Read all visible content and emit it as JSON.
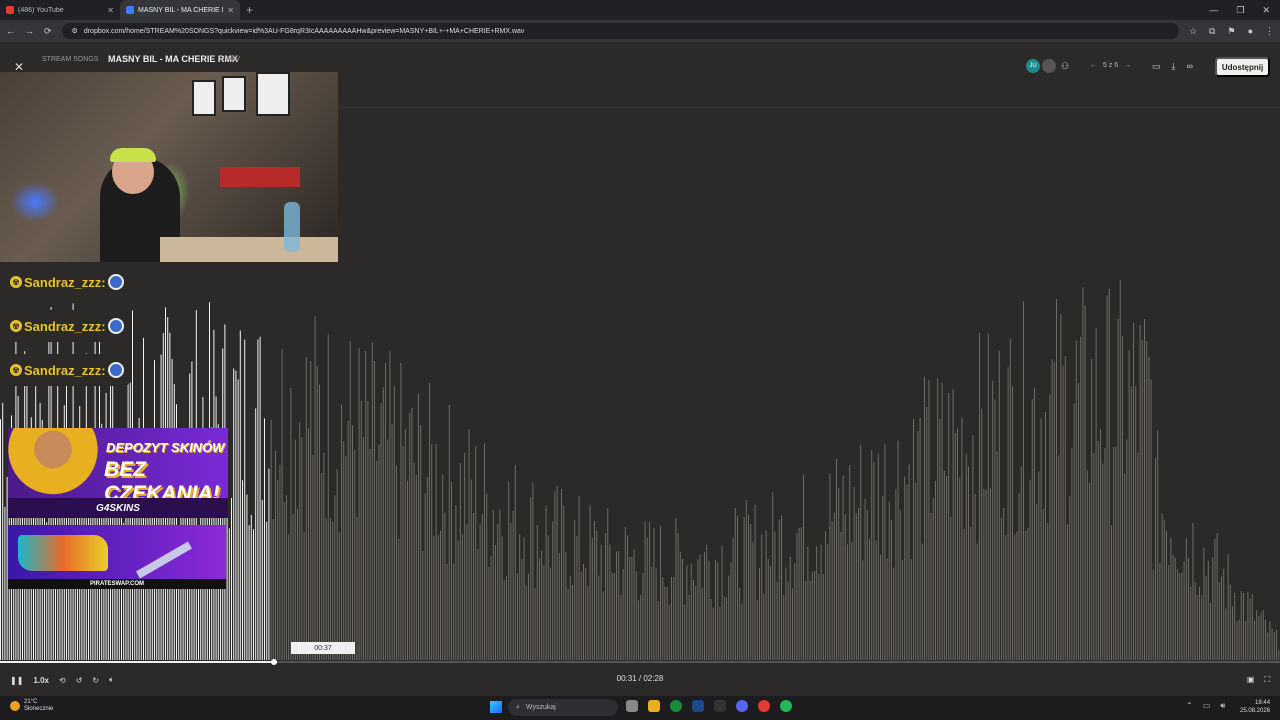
{
  "browser": {
    "tabs": [
      {
        "title": "(486) YouTube",
        "favicon_color": "#e53935"
      },
      {
        "title": "MASNY BIL - MA CHERIE R",
        "favicon_color": "#3d7bff"
      }
    ],
    "url": "dropbox.com/home/STREAM%20SONGS?quickview=id%3AU-FG8rqR3IcAAAAAAAAAHw&preview=MASNY+BIL+-+MA+CHERIE+RMX.wav"
  },
  "viewer": {
    "breadcrumb": "STREAM SONGS",
    "file_title": "MASNY BIL - MA CHERIE RMX",
    "file_ext": "WAV",
    "avatar_initials": "JU",
    "pager": "5 z 6",
    "share_label": "Udostępnij",
    "hover_time": "00:37",
    "playback_speed": "1.0x",
    "current_time": "00:31",
    "total_time": "02:28",
    "time_readout": "00:31 / 02:28",
    "progress_fraction": 0.21
  },
  "overlay": {
    "chat_messages": [
      {
        "user": "Sandraz_zzz:"
      },
      {
        "user": "Sandraz_zzz:"
      },
      {
        "user": "Sandraz_zzz:"
      }
    ],
    "ad1_line1": "DEPOZYT SKINÓW",
    "ad1_line2": "BEZ CZEKANIA!",
    "ad1_brand": "G4SKINS",
    "ad2_brand": "PIRATESWAP.COM"
  },
  "taskbar": {
    "weather_temp": "21°C",
    "weather_desc": "Słonecznie",
    "search_placeholder": "Wyszukaj",
    "time": "18:44",
    "date": "25.08.2026"
  }
}
